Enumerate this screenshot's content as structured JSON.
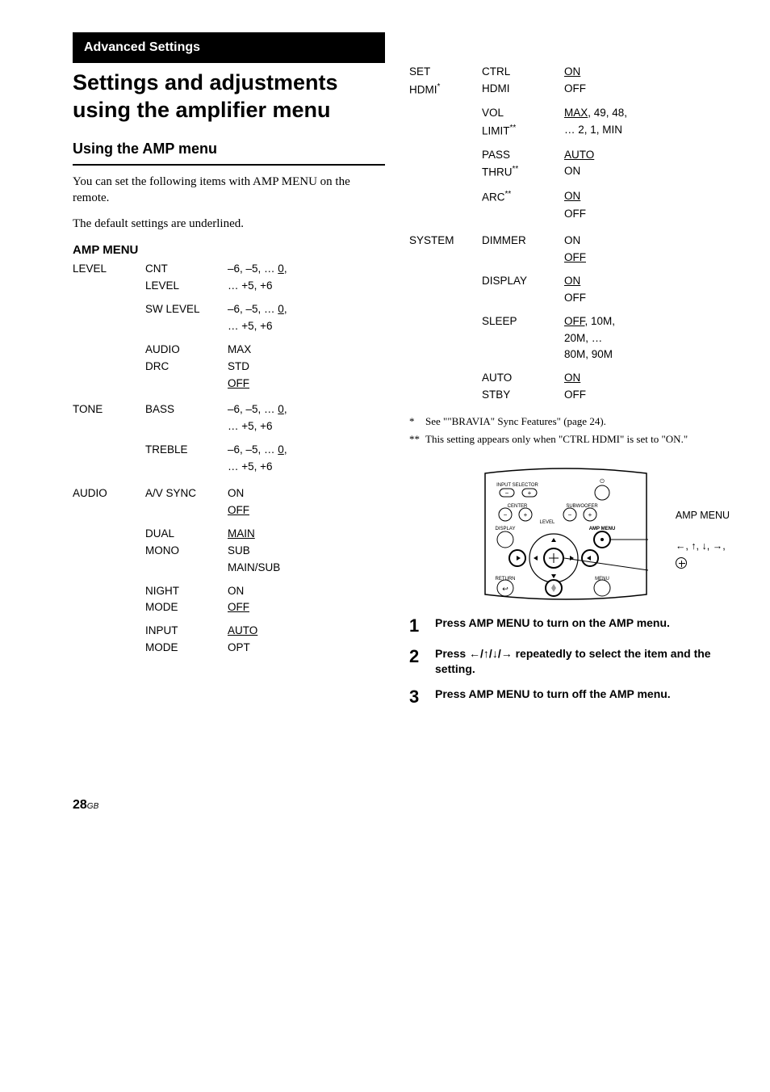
{
  "section_label": "Advanced Settings",
  "title": "Settings and adjustments using the amplifier menu",
  "subtitle": "Using the AMP menu",
  "intro_1": "You can set the following items with AMP MENU on the remote.",
  "intro_2": "The default settings are underlined.",
  "menu_heading": "AMP MENU",
  "tree": {
    "level": {
      "label": "LEVEL",
      "cnt_level": {
        "label": "CNT LEVEL",
        "line1": "CNT",
        "line2": "LEVEL",
        "vals_a": "–6, –5, … ",
        "default": "0",
        "tail": ",",
        "vals_b": "… +5, +6"
      },
      "sw_level": {
        "label": "SW LEVEL",
        "vals_a": "–6, –5, … ",
        "default": "0",
        "tail": ",",
        "vals_b": "… +5, +6"
      },
      "audio_drc": {
        "line1": "AUDIO",
        "line2": "DRC",
        "opts": [
          "MAX",
          "STD"
        ],
        "default": "OFF"
      }
    },
    "tone": {
      "label": "TONE",
      "bass": {
        "label": "BASS",
        "vals_a": "–6, –5, … ",
        "default": "0",
        "tail": ",",
        "vals_b": "… +5, +6"
      },
      "treble": {
        "label": "TREBLE",
        "vals_a": "–6, –5, … ",
        "default": "0",
        "tail": ",",
        "vals_b": "… +5, +6"
      }
    },
    "audio": {
      "label": "AUDIO",
      "av_sync": {
        "label": "A/V SYNC",
        "opts": [
          "ON"
        ],
        "default": "OFF"
      },
      "dual_mono": {
        "line1": "DUAL",
        "line2": "MONO",
        "default": "MAIN",
        "opts": [
          "SUB",
          "MAIN/SUB"
        ]
      },
      "night_mode": {
        "line1": "NIGHT",
        "line2": "MODE",
        "opts": [
          "ON"
        ],
        "default": "OFF"
      },
      "input_mode": {
        "line1": "INPUT",
        "line2": "MODE",
        "default": "AUTO",
        "opts": [
          "OPT"
        ]
      }
    },
    "set_hdmi": {
      "line1": "SET",
      "line2": "HDMI",
      "sup": "*",
      "ctrl_hdmi": {
        "line1": "CTRL",
        "line2": "HDMI",
        "default": "ON",
        "opts": [
          "OFF"
        ]
      },
      "vol_limit": {
        "line1": "VOL",
        "line2": "LIMIT",
        "sup": "**",
        "default": "MAX",
        "tail_a": ", 49, 48,",
        "vals_b": "… 2, 1, MIN"
      },
      "pass_thru": {
        "line1": "PASS",
        "line2": "THRU",
        "sup": "**",
        "default": "AUTO",
        "opts": [
          "ON"
        ]
      },
      "arc": {
        "label": "ARC",
        "sup": "**",
        "default": "ON",
        "opts": [
          "OFF"
        ]
      }
    },
    "system": {
      "label": "SYSTEM",
      "dimmer": {
        "label": "DIMMER",
        "opts": [
          "ON"
        ],
        "default": "OFF"
      },
      "display": {
        "label": "DISPLAY",
        "default": "ON",
        "opts": [
          "OFF"
        ]
      },
      "sleep": {
        "label": "SLEEP",
        "default": "OFF",
        "tail_a": ", 10M,",
        "vals_b": "20M, …",
        "vals_c": "80M, 90M"
      },
      "auto_stby": {
        "line1": "AUTO",
        "line2": "STBY",
        "default": "ON",
        "opts": [
          "OFF"
        ]
      }
    }
  },
  "note1_mark": "*",
  "note1": "See \"\"BRAVIA\" Sync Features\" (page 24).",
  "note2_mark": "**",
  "note2": "This setting appears only when \"CTRL HDMI\" is set to \"ON.\"",
  "remote": {
    "input_selector": "INPUT SELECTOR",
    "center": "CENTER",
    "subwoofer": "SUBWOOFER",
    "level": "LEVEL",
    "display": "DISPLAY",
    "amp_menu": "AMP MENU",
    "return": "RETURN",
    "menu": "MENU",
    "label_amp_menu": "AMP MENU",
    "label_arrows": "←, ↑, ↓, →,"
  },
  "steps": {
    "s1_num": "1",
    "s1": "Press AMP MENU to turn on the AMP menu.",
    "s2_num": "2",
    "s2_a": "Press ",
    "s2_arrows": "←/↑/↓/→",
    "s2_b": " repeatedly to select the item and the setting.",
    "s3_num": "3",
    "s3": "Press AMP MENU to turn off the AMP menu."
  },
  "page_number": "28",
  "page_region": "GB"
}
